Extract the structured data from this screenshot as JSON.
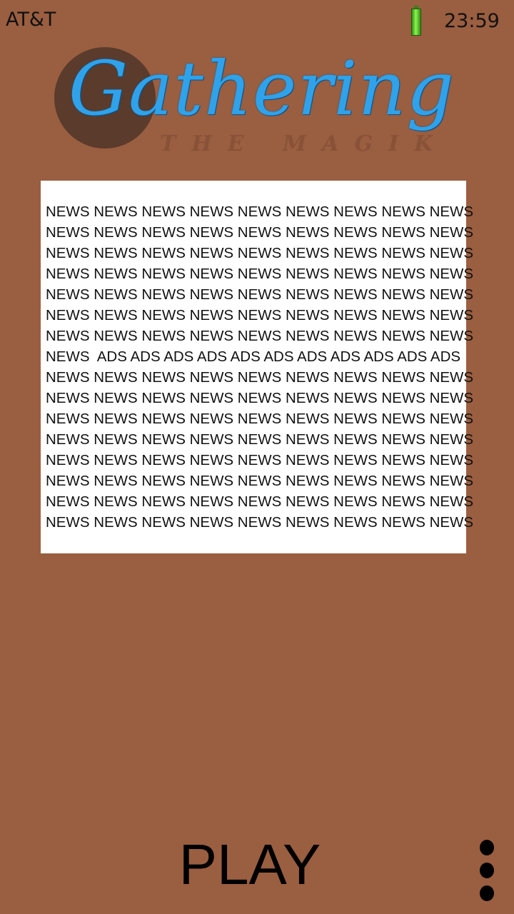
{
  "status_bar": {
    "carrier": "AT&T",
    "time": "23:59",
    "battery_icon": "battery-full-icon",
    "battery_color": "#4cd12a"
  },
  "logo": {
    "title": "Gathering",
    "subtitle": "THE MAGIK",
    "title_color": "#2fa2ea",
    "circle_color": "#5a3b2c"
  },
  "news": {
    "lines": [
      "NEWS NEWS NEWS NEWS NEWS NEWS NEWS NEWS NEWS",
      "NEWS NEWS NEWS NEWS NEWS NEWS NEWS NEWS NEWS",
      "NEWS NEWS NEWS NEWS NEWS NEWS NEWS NEWS NEWS",
      "NEWS NEWS NEWS NEWS NEWS NEWS NEWS NEWS NEWS",
      "NEWS NEWS NEWS NEWS NEWS NEWS NEWS NEWS NEWS",
      "NEWS NEWS NEWS NEWS NEWS NEWS NEWS NEWS NEWS",
      "NEWS NEWS NEWS NEWS NEWS NEWS NEWS NEWS NEWS",
      "NEWS  ADS ADS ADS ADS ADS ADS ADS ADS ADS ADS ADS",
      "NEWS NEWS NEWS NEWS NEWS NEWS NEWS NEWS NEWS",
      "NEWS NEWS NEWS NEWS NEWS NEWS NEWS NEWS NEWS",
      "NEWS NEWS NEWS NEWS NEWS NEWS NEWS NEWS NEWS",
      "NEWS NEWS NEWS NEWS NEWS NEWS NEWS NEWS NEWS",
      "NEWS NEWS NEWS NEWS NEWS NEWS NEWS NEWS NEWS",
      "NEWS NEWS NEWS NEWS NEWS NEWS NEWS NEWS NEWS",
      "NEWS NEWS NEWS NEWS NEWS NEWS NEWS NEWS NEWS",
      "NEWS NEWS NEWS NEWS NEWS NEWS NEWS NEWS NEWS"
    ]
  },
  "actions": {
    "play_label": "PLAY",
    "menu_icon": "more-vertical-icon"
  },
  "colors": {
    "background": "#9a5e40",
    "news_background": "#ffffff"
  }
}
